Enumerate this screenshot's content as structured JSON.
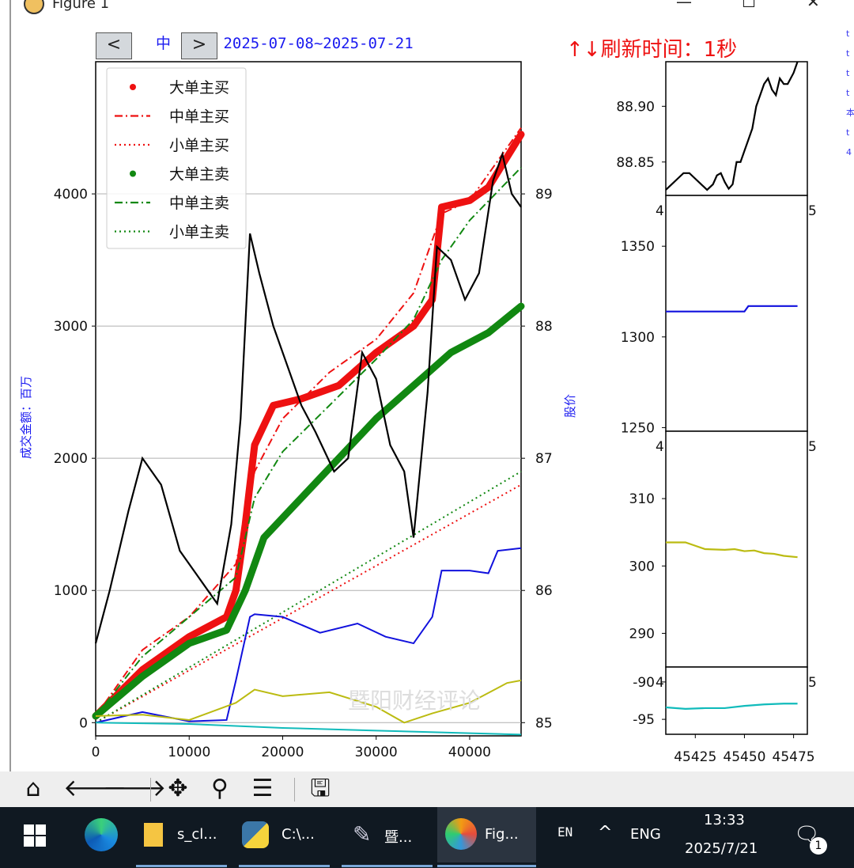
{
  "window": {
    "title": "Figure 1",
    "icon": "matplotlib-icon",
    "controls": [
      "minimize-icon",
      "maximize-icon",
      "close-icon"
    ]
  },
  "header": {
    "prev_label": "<",
    "next_label": ">",
    "title_text": "中",
    "title_rest": "示 2025-07-08~2025-07-21",
    "refresh_text": "↑↓刷新时间：1秒"
  },
  "main_chart": {
    "ylabel_left": "成交金额：百万",
    "ylabel_right": "股价",
    "watermark": "暨阳财经评论",
    "x_ticks": [
      "0",
      "10000",
      "20000",
      "30000",
      "40000"
    ],
    "y_left_ticks": [
      "0",
      "1000",
      "2000",
      "3000",
      "4000"
    ],
    "y_right_ticks": [
      "85",
      "86",
      "87",
      "88",
      "89"
    ],
    "legend": [
      "大单主买",
      "中单主买",
      "小单主买",
      "大单主卖",
      "中单主卖",
      "小单主卖"
    ]
  },
  "side_charts": {
    "p1_ticks": [
      "88.90",
      "88.85"
    ],
    "p2_ticks": [
      "1350",
      "1300",
      "1250"
    ],
    "p3_ticks": [
      "310",
      "300",
      "290"
    ],
    "p4_ticks": [
      "-90",
      "-95"
    ],
    "x_ticks": [
      "45425",
      "45450",
      "45475"
    ],
    "clipped_labels": [
      "4",
      "5"
    ]
  },
  "right_strip": [
    "t",
    "t",
    "t",
    "t",
    "本",
    "t",
    "4"
  ],
  "toolbar": {
    "buttons": [
      "home-icon",
      "back-icon",
      "forward-icon",
      "pan-icon",
      "zoom-icon",
      "configure-subplots-icon",
      "save-icon"
    ]
  },
  "taskbar": {
    "items": [
      {
        "name": "s_cl...",
        "icon": "folder-icon"
      },
      {
        "name": "C:\\...",
        "icon": "python-icon"
      },
      {
        "name": "暨...",
        "icon": "feather-icon"
      },
      {
        "name": "Fig...",
        "icon": "matplotlib-icon"
      }
    ],
    "ime": "EN",
    "lang": "ENG",
    "time": "13:33",
    "date": "2025/7/21",
    "notification_count": "1"
  },
  "chart_data": [
    {
      "type": "line",
      "title": "中 示 2025-07-08~2025-07-21",
      "xlabel": "",
      "ylabel": "成交金额：百万",
      "y2label": "股价",
      "xlim": [
        0,
        45500
      ],
      "ylim": [
        -100,
        5000
      ],
      "y2lim": [
        84.9,
        90.0
      ],
      "grid": true,
      "legend_position": "top-left",
      "series": [
        {
          "name": "大单主买",
          "style": "dots",
          "color": "#ee1111",
          "x": [
            0,
            5000,
            10000,
            14000,
            15000,
            16000,
            17000,
            19000,
            22000,
            26000,
            30000,
            34000,
            36000,
            37000,
            40000,
            42000,
            45500
          ],
          "y": [
            50,
            400,
            650,
            800,
            1000,
            1500,
            2100,
            2400,
            2450,
            2550,
            2800,
            3000,
            3200,
            3900,
            3950,
            4050,
            4450
          ]
        },
        {
          "name": "中单主买",
          "style": "dashdot",
          "color": "#ee1111",
          "x": [
            0,
            5000,
            10000,
            15000,
            17000,
            20000,
            25000,
            30000,
            34000,
            37000,
            40000,
            45500
          ],
          "y": [
            50,
            550,
            800,
            1200,
            1900,
            2300,
            2650,
            2900,
            3250,
            3850,
            3950,
            4500
          ]
        },
        {
          "name": "小单主买",
          "style": "dotted",
          "color": "#ee1111",
          "x": [
            0,
            45500
          ],
          "y": [
            0,
            1800
          ]
        },
        {
          "name": "大单主卖",
          "style": "dots",
          "color": "#118811",
          "x": [
            0,
            5000,
            10000,
            14000,
            16000,
            18000,
            22000,
            26000,
            30000,
            34000,
            38000,
            42000,
            45500
          ],
          "y": [
            50,
            350,
            600,
            700,
            1000,
            1400,
            1700,
            2000,
            2300,
            2550,
            2800,
            2950,
            3150
          ]
        },
        {
          "name": "中单主卖",
          "style": "dashdot",
          "color": "#118811",
          "x": [
            0,
            5000,
            10000,
            15000,
            17000,
            20000,
            25000,
            30000,
            34000,
            37000,
            40000,
            45500
          ],
          "y": [
            50,
            500,
            800,
            1100,
            1700,
            2050,
            2400,
            2750,
            3050,
            3500,
            3800,
            4200
          ]
        },
        {
          "name": "小单主卖",
          "style": "dotted",
          "color": "#118811",
          "x": [
            0,
            45500
          ],
          "y": [
            0,
            1900
          ]
        },
        {
          "name": "",
          "axis": "left",
          "color": "#1111dd",
          "x": [
            0,
            5000,
            10000,
            14000,
            15000,
            16500,
            17000,
            20000,
            24000,
            28000,
            31000,
            34000,
            36000,
            37000,
            40000,
            42000,
            43000,
            45500
          ],
          "y": [
            0,
            80,
            10,
            20,
            320,
            800,
            820,
            800,
            680,
            750,
            650,
            600,
            800,
            1150,
            1150,
            1130,
            1300,
            1320
          ]
        },
        {
          "name": "",
          "axis": "left",
          "color": "#bbbb11",
          "x": [
            0,
            5000,
            10000,
            15000,
            17000,
            20000,
            25000,
            30000,
            33000,
            36000,
            40000,
            44000,
            45500
          ],
          "y": [
            50,
            60,
            20,
            150,
            250,
            200,
            230,
            120,
            0,
            70,
            150,
            300,
            320
          ]
        },
        {
          "name": "",
          "axis": "left",
          "color": "#11bbbb",
          "x": [
            0,
            10000,
            20000,
            30000,
            40000,
            45500
          ],
          "y": [
            0,
            -10,
            -40,
            -60,
            -80,
            -90
          ]
        },
        {
          "name": "",
          "axis": "right",
          "color": "#000000",
          "x": [
            0,
            1500,
            3500,
            5000,
            7000,
            9000,
            11000,
            13000,
            14500,
            15500,
            16500,
            17500,
            19000,
            20500,
            22000,
            23500,
            25500,
            27000,
            28500,
            30000,
            31500,
            33000,
            34000,
            35500,
            36500,
            38000,
            39500,
            41000,
            42500,
            43500,
            44500,
            45500
          ],
          "y": [
            85.6,
            86.0,
            86.6,
            87.0,
            86.8,
            86.3,
            86.1,
            85.9,
            86.5,
            87.3,
            88.7,
            88.4,
            88.0,
            87.7,
            87.4,
            87.2,
            86.9,
            87.0,
            87.8,
            87.6,
            87.1,
            86.9,
            86.4,
            87.5,
            88.6,
            88.5,
            88.2,
            88.4,
            89.1,
            89.3,
            89.0,
            88.9
          ]
        }
      ]
    },
    {
      "type": "line",
      "title": "",
      "xlim": [
        45410,
        45482
      ],
      "ylim": [
        88.82,
        88.94
      ],
      "series": [
        {
          "name": "",
          "color": "#000000",
          "x": [
            45410,
            45413,
            45416,
            45419,
            45422,
            45425,
            45428,
            45431,
            45434,
            45436,
            45438,
            45440,
            45442,
            45444,
            45446,
            45448,
            45450,
            45452,
            45454,
            45456,
            45458,
            45460,
            45462,
            45464,
            45466,
            45468,
            45470,
            45472,
            45475,
            45477
          ],
          "y": [
            88.825,
            88.83,
            88.835,
            88.84,
            88.84,
            88.835,
            88.83,
            88.825,
            88.83,
            88.838,
            88.84,
            88.832,
            88.826,
            88.83,
            88.85,
            88.85,
            88.86,
            88.87,
            88.88,
            88.9,
            88.91,
            88.92,
            88.925,
            88.915,
            88.91,
            88.925,
            88.92,
            88.92,
            88.93,
            88.94
          ]
        }
      ]
    },
    {
      "type": "line",
      "title": "",
      "xlim": [
        45410,
        45482
      ],
      "ylim": [
        1248,
        1378
      ],
      "series": [
        {
          "name": "",
          "color": "#1111dd",
          "x": [
            45410,
            45440,
            45450,
            45452,
            45477
          ],
          "y": [
            1314,
            1314,
            1314,
            1317,
            1317
          ]
        }
      ]
    },
    {
      "type": "line",
      "title": "",
      "xlim": [
        45410,
        45482
      ],
      "ylim": [
        285,
        320
      ],
      "series": [
        {
          "name": "",
          "color": "#bbbb11",
          "x": [
            45410,
            45420,
            45425,
            45430,
            45440,
            45445,
            45450,
            45455,
            45460,
            45465,
            45470,
            45477
          ],
          "y": [
            303.5,
            303.5,
            303.0,
            302.5,
            302.4,
            302.5,
            302.2,
            302.3,
            301.9,
            301.8,
            301.5,
            301.3
          ]
        }
      ]
    },
    {
      "type": "line",
      "title": "",
      "xlim": [
        45410,
        45482
      ],
      "ylim": [
        -97,
        -88
      ],
      "series": [
        {
          "name": "",
          "color": "#11bbbb",
          "x": [
            45410,
            45420,
            45430,
            45440,
            45450,
            45460,
            45470,
            45477
          ],
          "y": [
            -93.4,
            -93.6,
            -93.5,
            -93.5,
            -93.2,
            -93.0,
            -92.9,
            -92.9
          ]
        }
      ]
    }
  ]
}
